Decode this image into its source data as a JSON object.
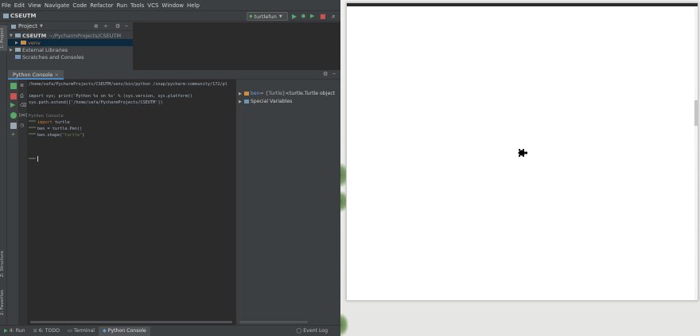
{
  "menubar": {
    "items": [
      "File",
      "Edit",
      "View",
      "Navigate",
      "Code",
      "Refactor",
      "Run",
      "Tools",
      "VCS",
      "Window",
      "Help"
    ]
  },
  "navbar": {
    "project_name": "CSEUTM",
    "run_config": "turtlefun"
  },
  "left_strip": {
    "project_tab": "1: Project",
    "structure_tab": "Z: Structure",
    "favorites_tab": "2: Favorites"
  },
  "project_panel": {
    "header": "Project",
    "tree": [
      {
        "label": "CSEUTM",
        "path": "~/PycharmProjects/CSEUTM"
      },
      {
        "label": "venv"
      },
      {
        "label": "External Libraries"
      },
      {
        "label": "Scratches and Consoles"
      }
    ]
  },
  "console": {
    "tab_label": "Python Console",
    "lines": {
      "cmd": "/home/safa/PycharmProjects/CSEUTM/venv/bin/python /snap/pycharm-community/172/pl",
      "line1": "import sys; print('Python %s on %s' % (sys.version, sys.platform))",
      "line2": "sys.path.extend(['/home/safa/PycharmProjects/CSEUTM'])",
      "banner": "Python Console",
      "in1_kw": "import",
      "in1_rest": " turtle",
      "in2": "ben = turtle.Pen()",
      "in3_a": "ben.shape(",
      "in3_str": "\"turtle\"",
      "in3_b": ")"
    }
  },
  "variables": {
    "row1_name": "ben",
    "row1_type": " = {Turtle} ",
    "row1_value": "<turtle.Turtle object",
    "row2": "Special Variables"
  },
  "statusbar": {
    "tabs": [
      "4: Run",
      "6: TODO",
      "Terminal",
      "Python Console"
    ],
    "event_log": "Event Log"
  },
  "colors": {
    "ide_bg": "#3c3f41",
    "editor_bg": "#2b2b2b",
    "selection": "#0d293e",
    "accent": "#4a88c7",
    "run_green": "#59a869",
    "folder_orange": "#c98b45"
  }
}
